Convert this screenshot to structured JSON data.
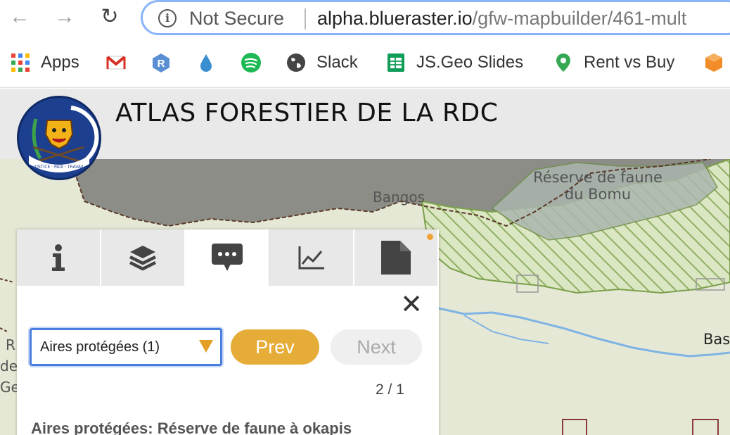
{
  "browser": {
    "address_security": "Not Secure",
    "url_host": "alpha.blueraster.io",
    "url_path": "/gfw-mapbuilder/461-mult"
  },
  "bookmarks": [
    {
      "label": "Apps",
      "icon": "apps-grid-icon"
    },
    {
      "label": "",
      "icon": "gmail-icon"
    },
    {
      "label": "",
      "icon": "r-icon"
    },
    {
      "label": "",
      "icon": "water-drop-icon"
    },
    {
      "label": "",
      "icon": "spotify-icon"
    },
    {
      "label": "Slack",
      "icon": "globe-icon"
    },
    {
      "label": "JS.Geo Slides",
      "icon": "sheets-icon"
    },
    {
      "label": "Rent vs Buy",
      "icon": "map-pin-icon"
    },
    {
      "label": "",
      "icon": "cube-icon"
    }
  ],
  "app": {
    "title": "ATLAS FORESTIER DE LA RDC",
    "emblem_text": "JUSTICE · PAIX · TRAVAIL"
  },
  "map_labels": {
    "reserve_line1": "Réserve de faune",
    "reserve_line2": "du Bomu",
    "town_bangos": "Bangos",
    "town_bas": "Bas",
    "left_r": "R",
    "left_de": "de",
    "left_ge": "Ge"
  },
  "panel": {
    "tabs": [
      {
        "name": "info",
        "icon": "info-icon"
      },
      {
        "name": "layers",
        "icon": "layers-icon"
      },
      {
        "name": "comments",
        "icon": "comment-icon"
      },
      {
        "name": "analysis",
        "icon": "chart-icon"
      },
      {
        "name": "document",
        "icon": "document-icon"
      }
    ],
    "active_tab": "comments",
    "layer_select_value": "Aires protégées (1)",
    "prev_label": "Prev",
    "next_label": "Next",
    "pager": "2 / 1",
    "feature_title": "Aires protégées: Réserve de faune à okapis"
  },
  "colors": {
    "accent": "#e6ac38",
    "select_focus": "#4a7de0",
    "emblem_blue": "#1d3f8f"
  }
}
